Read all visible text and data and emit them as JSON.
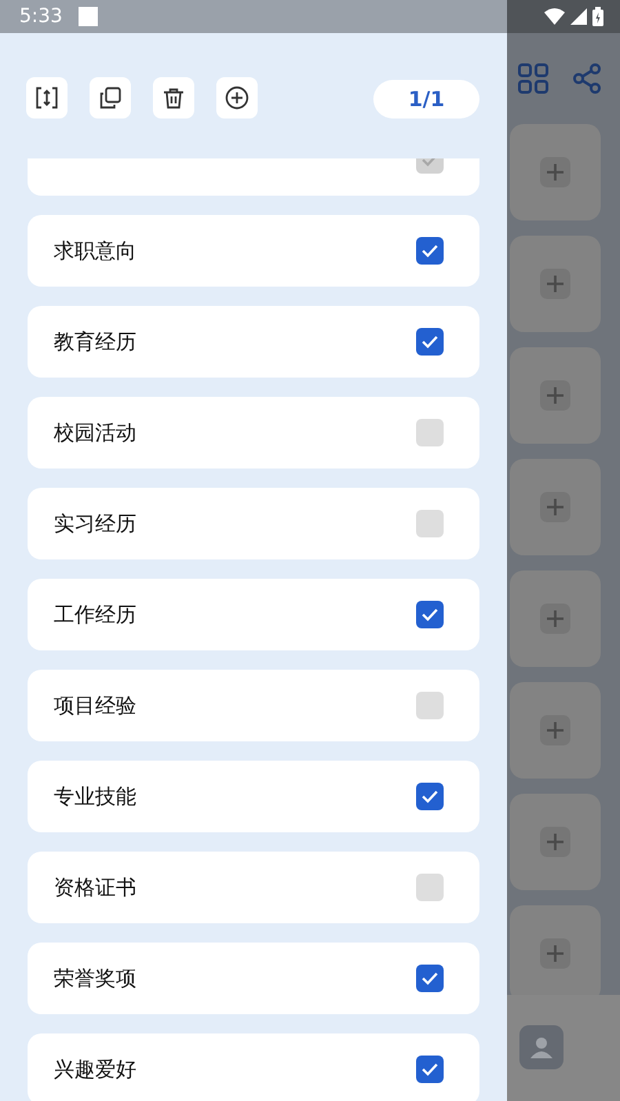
{
  "status_bar": {
    "time": "5:33"
  },
  "page_indicator": "1/1",
  "sections": [
    {
      "checked": true,
      "disabled": true
    },
    {
      "label": "求职意向",
      "checked": true,
      "disabled": false
    },
    {
      "label": "教育经历",
      "checked": true,
      "disabled": false
    },
    {
      "label": "校园活动",
      "checked": false,
      "disabled": false
    },
    {
      "label": "实习经历",
      "checked": false,
      "disabled": false
    },
    {
      "label": "工作经历",
      "checked": true,
      "disabled": false
    },
    {
      "label": "项目经验",
      "checked": false,
      "disabled": false
    },
    {
      "label": "专业技能",
      "checked": true,
      "disabled": false
    },
    {
      "label": "资格证书",
      "checked": false,
      "disabled": false
    },
    {
      "label": "荣誉奖项",
      "checked": true,
      "disabled": false
    },
    {
      "label": "兴趣爱好",
      "checked": true,
      "disabled": false
    }
  ]
}
